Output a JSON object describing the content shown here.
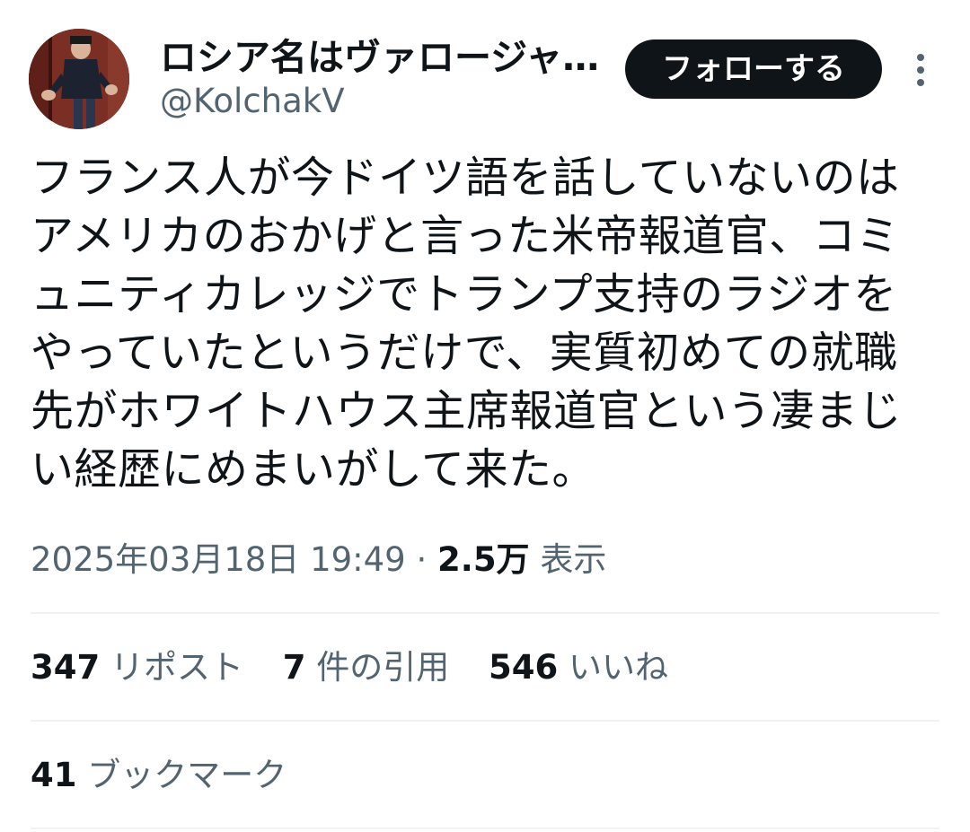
{
  "author": {
    "name": "ロシア名はヴァロージャ…",
    "handle": "@KolchakV"
  },
  "follow_label": "フォローする",
  "more_icon": "more-vertical-icon",
  "tweet": {
    "text": "フランス人が今ドイツ語を話していないのはアメリカのおかげと言った米帝報道官、コミュニティカレッジでトランプ支持のラジオをやっていたというだけで、実質初めての就職先がホワイトハウス主席報道官という凄まじい経歴にめまいがして来た。"
  },
  "meta": {
    "timestamp": "2025年03月18日 19:49",
    "separator": "·",
    "views_count": "2.5万",
    "views_label": "表示"
  },
  "stats": {
    "reposts_count": "347",
    "reposts_label": "リポスト",
    "quotes_count": "7",
    "quotes_label": "件の引用",
    "likes_count": "546",
    "likes_label": "いいね",
    "bookmarks_count": "41",
    "bookmarks_label": "ブックマーク"
  },
  "colors": {
    "text": "#0f1419",
    "secondary": "#536471",
    "divider": "#eff3f4",
    "button": "#0f1419"
  }
}
